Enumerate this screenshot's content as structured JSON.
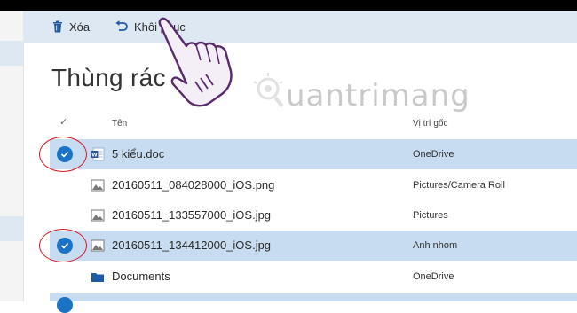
{
  "toolbar": {
    "delete_label": "Xóa",
    "restore_label": "Khôi phục"
  },
  "page": {
    "title": "Thùng rác"
  },
  "columns": {
    "check": "✓",
    "name": "Tên",
    "location": "Vị trí gốc"
  },
  "files": [
    {
      "name": "5 kiểu.doc",
      "location": "OneDrive",
      "type": "word-doc-icon",
      "selected": true
    },
    {
      "name": "20160511_084028000_iOS.png",
      "location": "Pictures/Camera Roll",
      "type": "image-file-icon",
      "selected": false
    },
    {
      "name": "20160511_133557000_iOS.jpg",
      "location": "Pictures",
      "type": "image-file-icon",
      "selected": false
    },
    {
      "name": "20160511_134412000_iOS.jpg",
      "location": "Anh nhom",
      "type": "image-file-icon",
      "selected": true
    },
    {
      "name": "Documents",
      "location": "OneDrive",
      "type": "folder-icon",
      "selected": false
    }
  ],
  "watermark": {
    "text": "uantrimang"
  },
  "colors": {
    "command_bar": "#dde8f3",
    "selected_row": "#c7dcf0",
    "accent": "#1a73c4",
    "annotation": "#d71920"
  }
}
